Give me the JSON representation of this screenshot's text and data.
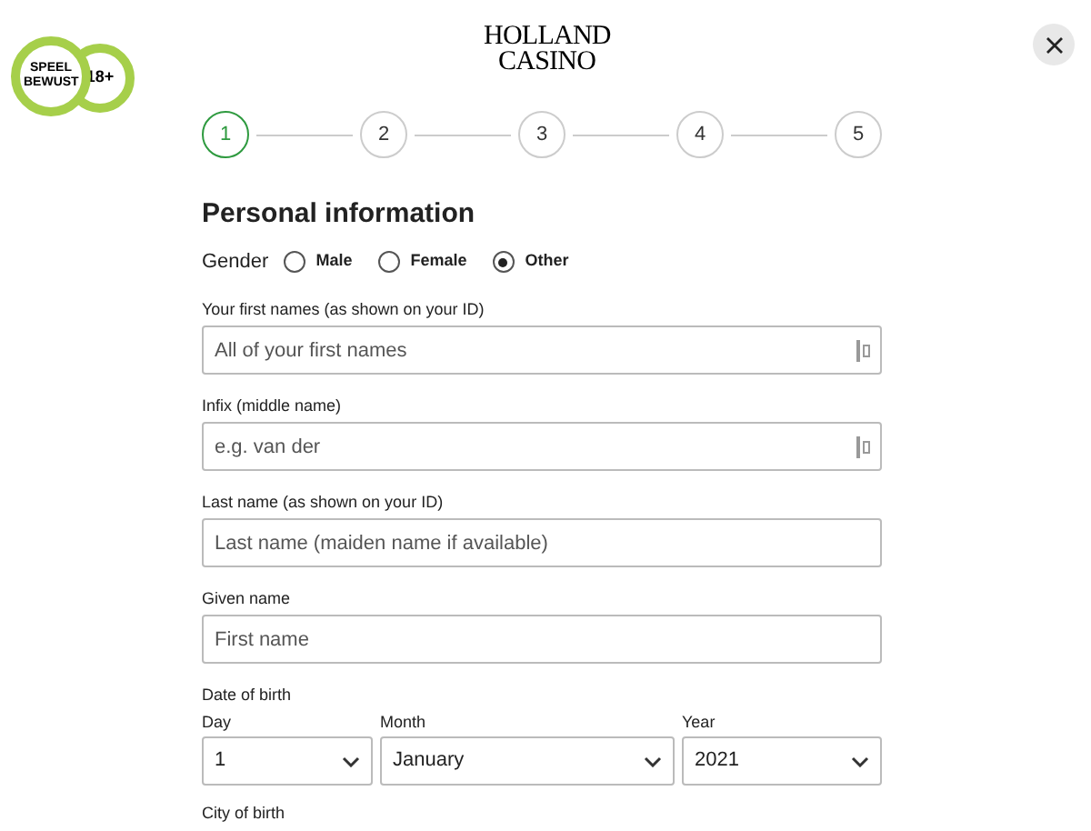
{
  "badge": {
    "left": "SPEEL BEWUST",
    "right": "18+"
  },
  "logo": {
    "line1": "HOLLAND",
    "line2": "CASINO"
  },
  "steps": [
    {
      "label": "1",
      "selected": true
    },
    {
      "label": "2",
      "selected": false
    },
    {
      "label": "3",
      "selected": false
    },
    {
      "label": "4",
      "selected": false
    },
    {
      "label": "5",
      "selected": false
    }
  ],
  "heading": "Personal information",
  "gender": {
    "label": "Gender",
    "options": [
      {
        "label": "Male",
        "selected": false
      },
      {
        "label": "Female",
        "selected": false
      },
      {
        "label": "Other",
        "selected": true
      }
    ]
  },
  "fields": [
    {
      "label": "Your first names (as shown on your ID)",
      "placeholder": "All of your first names",
      "autofill_icon": true
    },
    {
      "label": "Infix (middle name)",
      "placeholder": "e.g. van der",
      "autofill_icon": true
    },
    {
      "label": "Last name (as shown on your ID)",
      "placeholder": "Last name (maiden name if available)",
      "autofill_icon": false
    },
    {
      "label": "Given name",
      "placeholder": "First name",
      "autofill_icon": false
    }
  ],
  "date_of_birth": {
    "label": "Date of birth",
    "parts": [
      {
        "label": "Day",
        "value": "1"
      },
      {
        "label": "Month",
        "value": "January"
      },
      {
        "label": "Year",
        "value": "2021"
      }
    ]
  },
  "next_label": "City of birth"
}
